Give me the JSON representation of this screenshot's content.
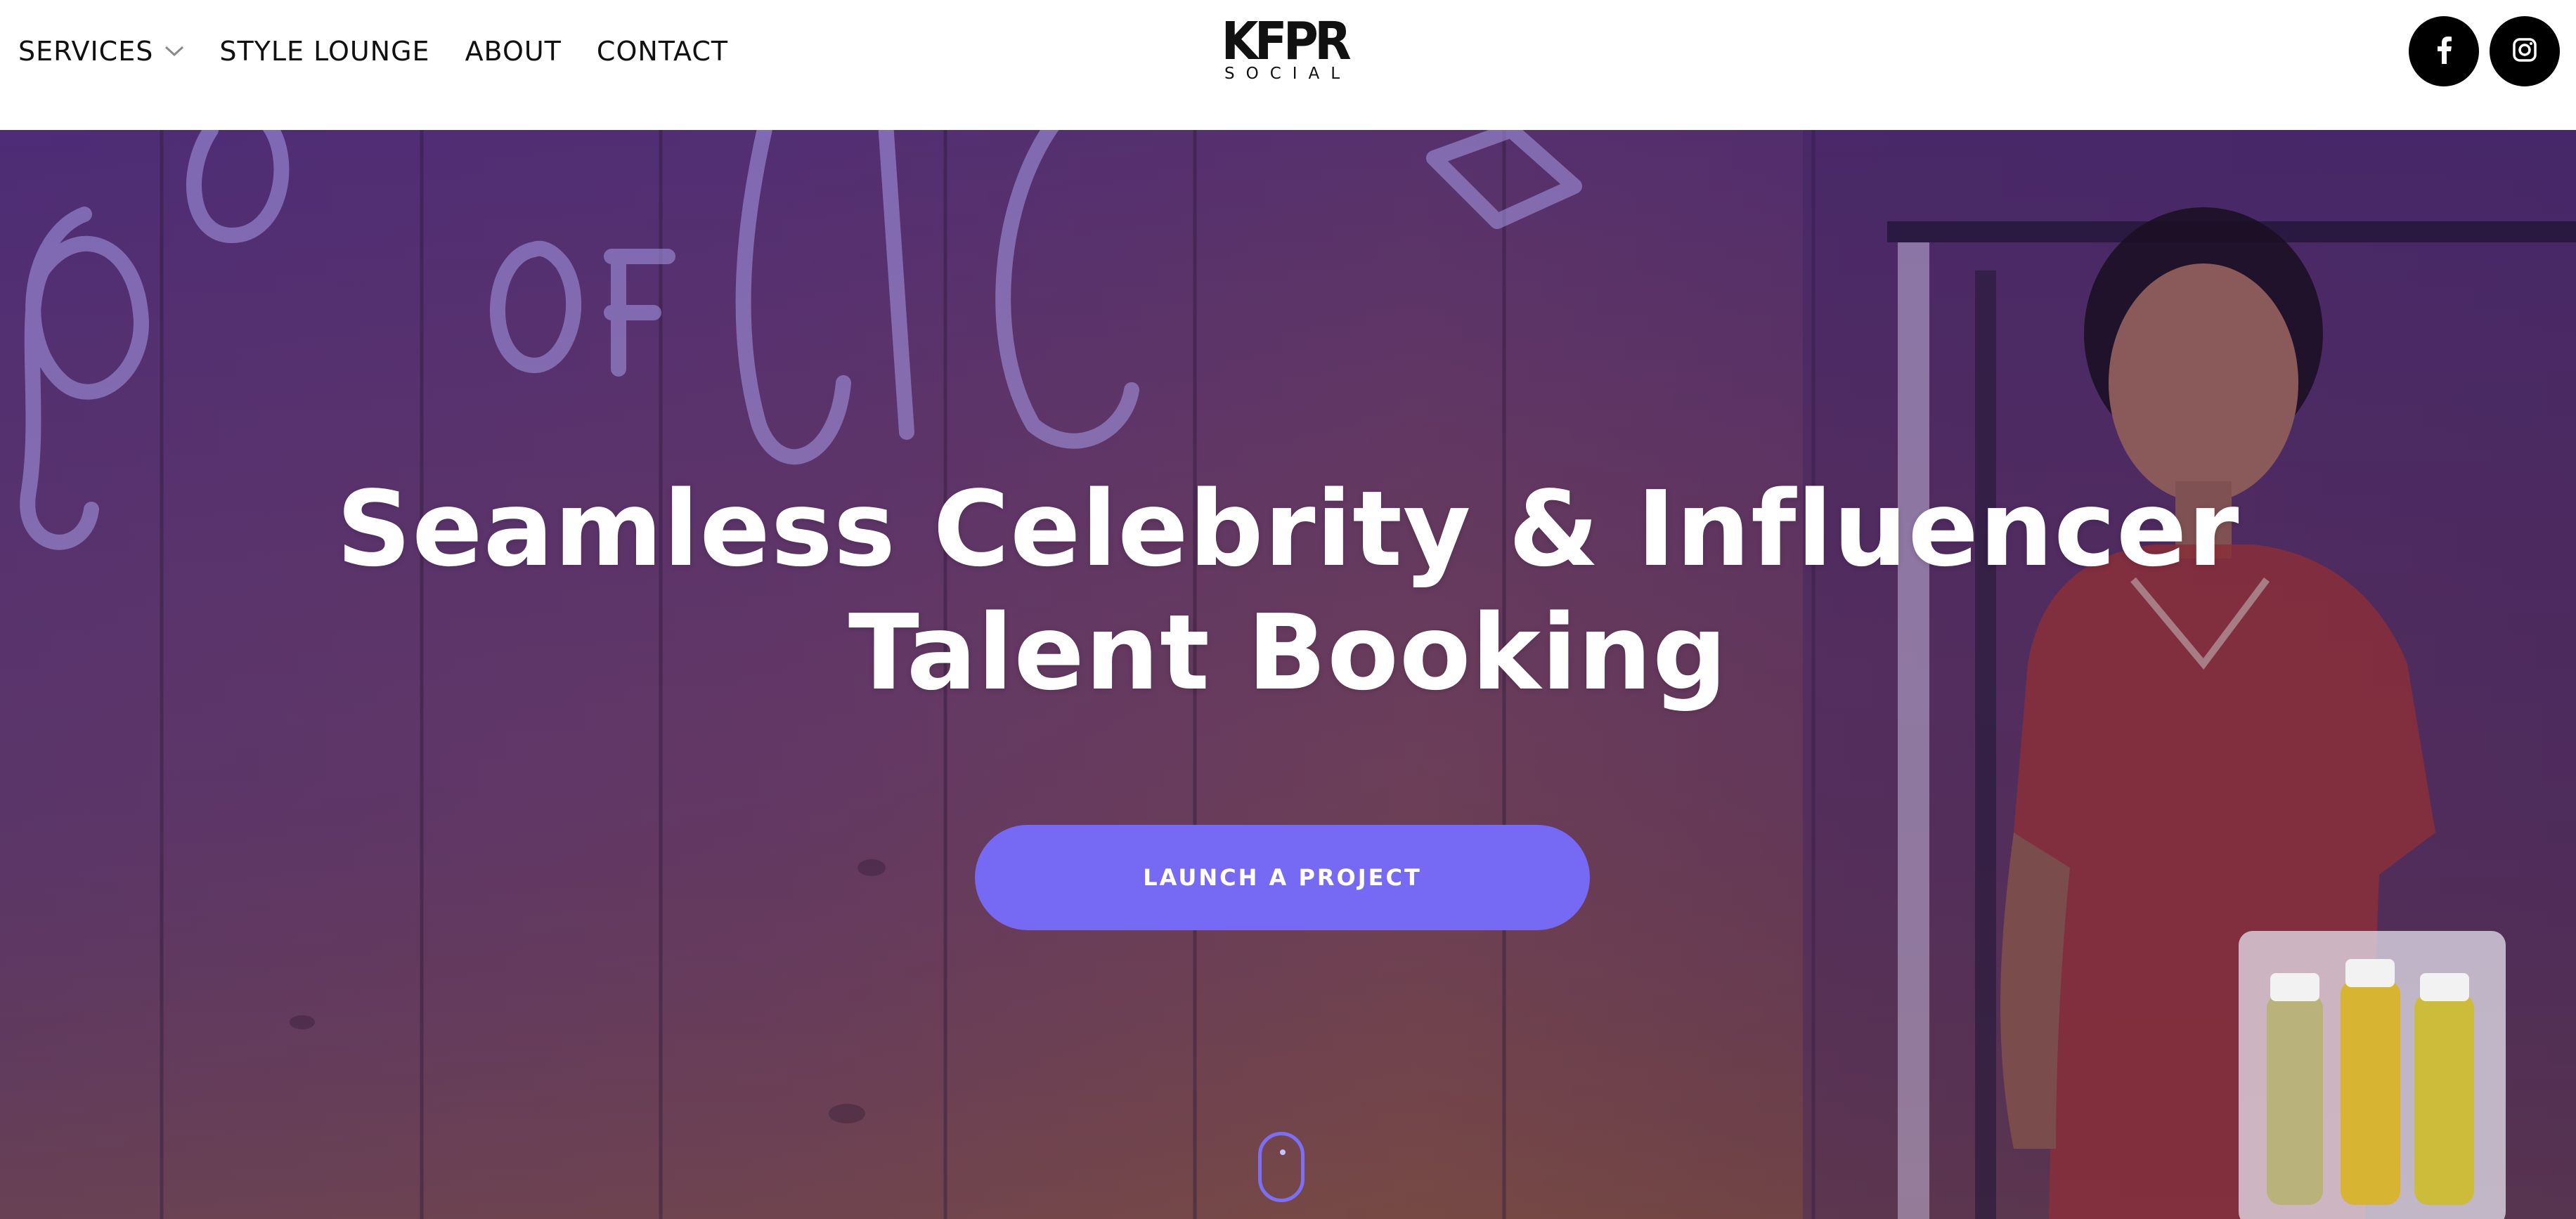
{
  "nav": {
    "items": [
      {
        "label": "SERVICES",
        "has_dropdown": true
      },
      {
        "label": "STYLE LOUNGE"
      },
      {
        "label": "ABOUT"
      },
      {
        "label": "CONTACT"
      }
    ]
  },
  "logo": {
    "text": "KFPR",
    "subtext": "SOCIAL"
  },
  "social": {
    "facebook_icon": "facebook-icon",
    "instagram_icon": "instagram-icon"
  },
  "hero": {
    "title_line1": "Seamless Celebrity & Influencer",
    "title_line2": "Talent Booking",
    "cta_label": "LAUNCH A PROJECT",
    "scroll_icon": "mouse-scroll-icon"
  },
  "colors": {
    "accent": "#7669f4",
    "overlay": "#5b3a8a",
    "header_bg": "#ffffff",
    "text_dark": "#111111"
  }
}
